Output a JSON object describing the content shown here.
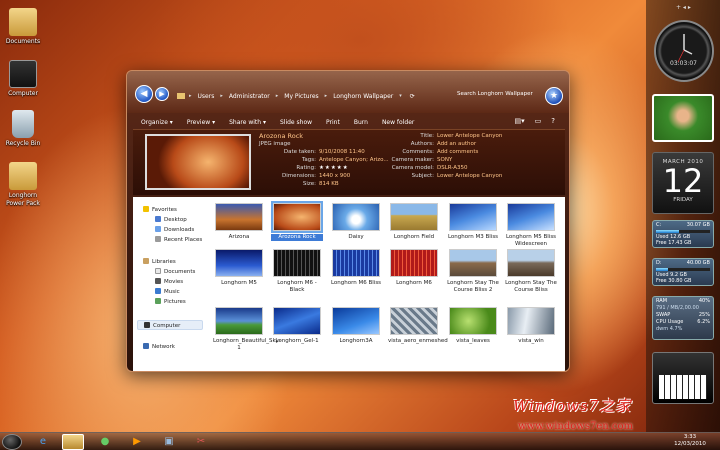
{
  "desktop": {
    "icons": [
      {
        "label": "Documents",
        "icon": "folder-icon"
      },
      {
        "label": "Computer",
        "icon": "computer-icon"
      },
      {
        "label": "Recycle Bin",
        "icon": "recycle-bin-icon"
      },
      {
        "label": "Longhorn Power Pack",
        "icon": "folder-icon"
      }
    ]
  },
  "explorer": {
    "breadcrumb": [
      "Users",
      "Administrator",
      "My Pictures",
      "Longhorn Wallpaper"
    ],
    "search_placeholder": "Search Longhorn Wallpaper",
    "toolbar": [
      "Organize ▾",
      "Preview ▾",
      "Share with ▾",
      "Slide show",
      "Print",
      "Burn",
      "New folder"
    ],
    "details": {
      "name": "Arozona Rock",
      "type": "JPEG image",
      "date_taken_label": "Date taken:",
      "date_taken": "9/10/2008 11:40",
      "tags_label": "Tags:",
      "tags": "Antelope Canyon; Arizo...",
      "rating_label": "Rating:",
      "rating": "★★★★★",
      "dimensions_label": "Dimensions:",
      "dimensions": "1440 x 900",
      "size_label": "Size:",
      "size": "814 KB",
      "title_label": "Title:",
      "title": "Lower Antelope Canyon",
      "authors_label": "Authors:",
      "authors": "Add an author",
      "comments_label": "Comments:",
      "comments": "Add comments",
      "camera_maker_label": "Camera maker:",
      "camera_maker": "SONY",
      "camera_model_label": "Camera model:",
      "camera_model": "DSLR-A350",
      "subject_label": "Subject:",
      "subject": "Lower Antelope Canyon"
    },
    "nav": {
      "favorites": "Favorites",
      "fav_items": [
        "Desktop",
        "Downloads",
        "Recent Places"
      ],
      "libraries": "Libraries",
      "lib_items": [
        "Documents",
        "Movies",
        "Music",
        "Pictures"
      ],
      "computer": "Computer",
      "network": "Network"
    },
    "files": [
      "Arizona",
      "Arozona Rock",
      "Daisy",
      "Longhorn Field",
      "Longhorn M3 Bliss",
      "Longhorn M5 Bliss Widescreen",
      "Longhorn M5",
      "Longhorn M6 - Black",
      "Longhorn M6 Bliss",
      "Longhorn M6",
      "Longhorn Stay The Course Bliss 2",
      "Longhorn Stay The Course Bliss",
      "Longhorn_Beautiful_Sky-1",
      "Longhorn_Gel-1",
      "Longhorn3A",
      "vista_aero_enmeshed",
      "vista_leaves",
      "vista_win"
    ],
    "selected_file": "Arozona Rock"
  },
  "gadgets": {
    "clock_digital": "03:03:07",
    "calendar": {
      "month": "MARCH 2010",
      "day": "12",
      "weekday": "FRIDAY"
    },
    "drives": [
      {
        "name": "C:",
        "total": "30.07 GB",
        "used": "Used 12.6 GB",
        "free": "Free 17.43 GB",
        "fraction": 0.42
      },
      {
        "name": "D:",
        "total": "40.00 GB",
        "used": "Used 9.2 GB",
        "free": "Free 30.80 GB",
        "fraction": 0.23
      }
    ],
    "sys": {
      "ram_label": "RAM",
      "ram": "40%",
      "ram_detail": "791 / MB/2,00.00",
      "swap_label": "SWAP",
      "swap": "25%",
      "cpu_label": "CPU Usage",
      "cpu": "6.2%",
      "cpu_detail": "dwm 4.7%"
    }
  },
  "taskbar": {
    "time": "3:33",
    "date": "12/03/2010"
  },
  "watermark": {
    "line1": "Windows7之家",
    "line2": "www.windows7en.com"
  }
}
